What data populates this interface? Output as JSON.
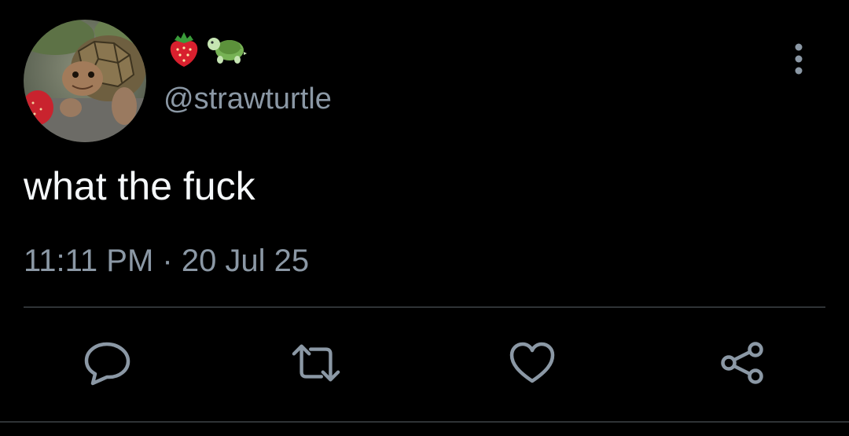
{
  "tweet": {
    "display_name_icons": [
      "strawberry-emoji",
      "turtle-emoji"
    ],
    "handle": "@strawturtle",
    "text": "what the fuck",
    "time": "11:11 PM",
    "separator": " · ",
    "date": "20 Jul 25"
  },
  "actions": {
    "reply_icon": "reply-icon",
    "retweet_icon": "retweet-icon",
    "like_icon": "heart-icon",
    "share_icon": "share-icon"
  },
  "colors": {
    "background": "#000000",
    "text": "#f5f8fa",
    "secondary": "#8b98a5",
    "divider": "#2f3336"
  }
}
